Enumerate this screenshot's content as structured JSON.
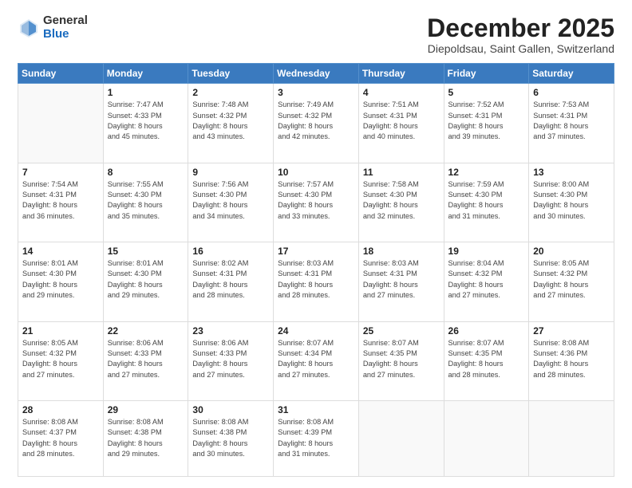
{
  "logo": {
    "general": "General",
    "blue": "Blue"
  },
  "title": "December 2025",
  "location": "Diepoldsau, Saint Gallen, Switzerland",
  "days_of_week": [
    "Sunday",
    "Monday",
    "Tuesday",
    "Wednesday",
    "Thursday",
    "Friday",
    "Saturday"
  ],
  "weeks": [
    [
      {
        "day": "",
        "info": ""
      },
      {
        "day": "1",
        "info": "Sunrise: 7:47 AM\nSunset: 4:33 PM\nDaylight: 8 hours\nand 45 minutes."
      },
      {
        "day": "2",
        "info": "Sunrise: 7:48 AM\nSunset: 4:32 PM\nDaylight: 8 hours\nand 43 minutes."
      },
      {
        "day": "3",
        "info": "Sunrise: 7:49 AM\nSunset: 4:32 PM\nDaylight: 8 hours\nand 42 minutes."
      },
      {
        "day": "4",
        "info": "Sunrise: 7:51 AM\nSunset: 4:31 PM\nDaylight: 8 hours\nand 40 minutes."
      },
      {
        "day": "5",
        "info": "Sunrise: 7:52 AM\nSunset: 4:31 PM\nDaylight: 8 hours\nand 39 minutes."
      },
      {
        "day": "6",
        "info": "Sunrise: 7:53 AM\nSunset: 4:31 PM\nDaylight: 8 hours\nand 37 minutes."
      }
    ],
    [
      {
        "day": "7",
        "info": "Sunrise: 7:54 AM\nSunset: 4:31 PM\nDaylight: 8 hours\nand 36 minutes."
      },
      {
        "day": "8",
        "info": "Sunrise: 7:55 AM\nSunset: 4:30 PM\nDaylight: 8 hours\nand 35 minutes."
      },
      {
        "day": "9",
        "info": "Sunrise: 7:56 AM\nSunset: 4:30 PM\nDaylight: 8 hours\nand 34 minutes."
      },
      {
        "day": "10",
        "info": "Sunrise: 7:57 AM\nSunset: 4:30 PM\nDaylight: 8 hours\nand 33 minutes."
      },
      {
        "day": "11",
        "info": "Sunrise: 7:58 AM\nSunset: 4:30 PM\nDaylight: 8 hours\nand 32 minutes."
      },
      {
        "day": "12",
        "info": "Sunrise: 7:59 AM\nSunset: 4:30 PM\nDaylight: 8 hours\nand 31 minutes."
      },
      {
        "day": "13",
        "info": "Sunrise: 8:00 AM\nSunset: 4:30 PM\nDaylight: 8 hours\nand 30 minutes."
      }
    ],
    [
      {
        "day": "14",
        "info": "Sunrise: 8:01 AM\nSunset: 4:30 PM\nDaylight: 8 hours\nand 29 minutes."
      },
      {
        "day": "15",
        "info": "Sunrise: 8:01 AM\nSunset: 4:30 PM\nDaylight: 8 hours\nand 29 minutes."
      },
      {
        "day": "16",
        "info": "Sunrise: 8:02 AM\nSunset: 4:31 PM\nDaylight: 8 hours\nand 28 minutes."
      },
      {
        "day": "17",
        "info": "Sunrise: 8:03 AM\nSunset: 4:31 PM\nDaylight: 8 hours\nand 28 minutes."
      },
      {
        "day": "18",
        "info": "Sunrise: 8:03 AM\nSunset: 4:31 PM\nDaylight: 8 hours\nand 27 minutes."
      },
      {
        "day": "19",
        "info": "Sunrise: 8:04 AM\nSunset: 4:32 PM\nDaylight: 8 hours\nand 27 minutes."
      },
      {
        "day": "20",
        "info": "Sunrise: 8:05 AM\nSunset: 4:32 PM\nDaylight: 8 hours\nand 27 minutes."
      }
    ],
    [
      {
        "day": "21",
        "info": "Sunrise: 8:05 AM\nSunset: 4:32 PM\nDaylight: 8 hours\nand 27 minutes."
      },
      {
        "day": "22",
        "info": "Sunrise: 8:06 AM\nSunset: 4:33 PM\nDaylight: 8 hours\nand 27 minutes."
      },
      {
        "day": "23",
        "info": "Sunrise: 8:06 AM\nSunset: 4:33 PM\nDaylight: 8 hours\nand 27 minutes."
      },
      {
        "day": "24",
        "info": "Sunrise: 8:07 AM\nSunset: 4:34 PM\nDaylight: 8 hours\nand 27 minutes."
      },
      {
        "day": "25",
        "info": "Sunrise: 8:07 AM\nSunset: 4:35 PM\nDaylight: 8 hours\nand 27 minutes."
      },
      {
        "day": "26",
        "info": "Sunrise: 8:07 AM\nSunset: 4:35 PM\nDaylight: 8 hours\nand 28 minutes."
      },
      {
        "day": "27",
        "info": "Sunrise: 8:08 AM\nSunset: 4:36 PM\nDaylight: 8 hours\nand 28 minutes."
      }
    ],
    [
      {
        "day": "28",
        "info": "Sunrise: 8:08 AM\nSunset: 4:37 PM\nDaylight: 8 hours\nand 28 minutes."
      },
      {
        "day": "29",
        "info": "Sunrise: 8:08 AM\nSunset: 4:38 PM\nDaylight: 8 hours\nand 29 minutes."
      },
      {
        "day": "30",
        "info": "Sunrise: 8:08 AM\nSunset: 4:38 PM\nDaylight: 8 hours\nand 30 minutes."
      },
      {
        "day": "31",
        "info": "Sunrise: 8:08 AM\nSunset: 4:39 PM\nDaylight: 8 hours\nand 31 minutes."
      },
      {
        "day": "",
        "info": ""
      },
      {
        "day": "",
        "info": ""
      },
      {
        "day": "",
        "info": ""
      }
    ]
  ]
}
